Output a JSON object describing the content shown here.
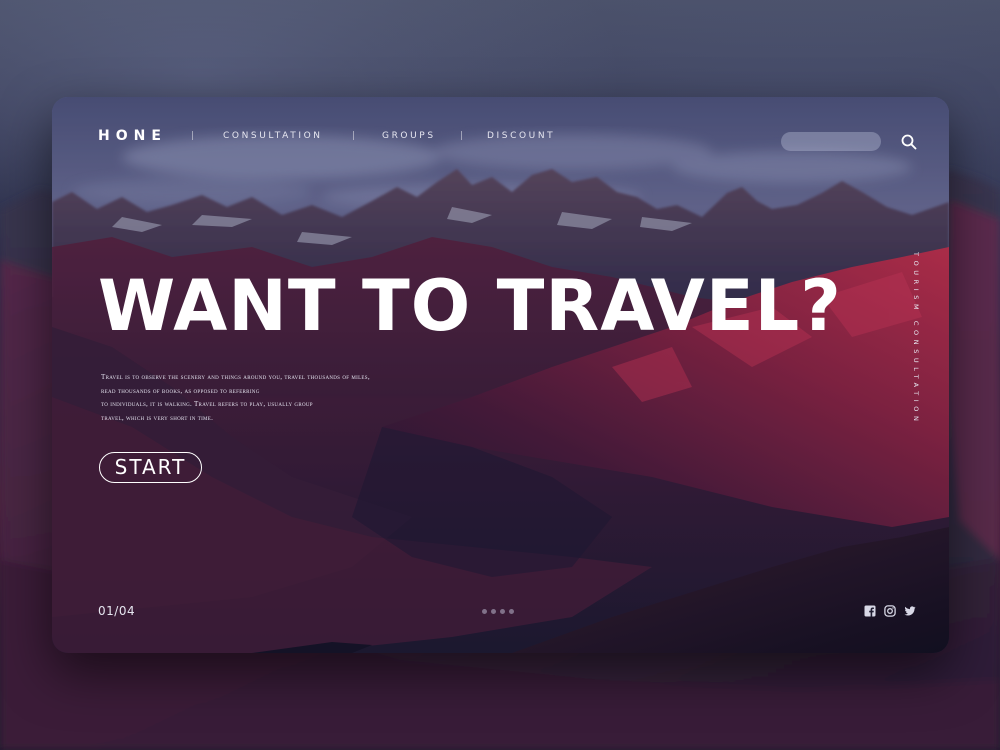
{
  "nav": {
    "logo": "HONE",
    "items": [
      {
        "label": "CONSULTATION"
      },
      {
        "label": "GROUPS"
      },
      {
        "label": "DISCOUNT"
      }
    ],
    "search_placeholder": ""
  },
  "hero": {
    "headline": "WANT TO TRAVEL?",
    "description_lines": [
      "Travel is to observe the scenery and things around you, travel thousands of miles,",
      "read thousands of books, as opposed to referring",
      "to individuals, it is walking. Travel refers to play, usually group",
      "travel, which is very short in time."
    ],
    "cta": "START",
    "side_label": "TOURISM CONSULTATION"
  },
  "pager": {
    "current": "01/04",
    "slide_count": 4,
    "active_index": 0
  },
  "socials": [
    "facebook-icon",
    "instagram-icon",
    "twitter-icon"
  ],
  "colors": {
    "text": "#ffffff",
    "search_pill": "#c8cde6",
    "accent_mountain": "#9c2a4a"
  }
}
